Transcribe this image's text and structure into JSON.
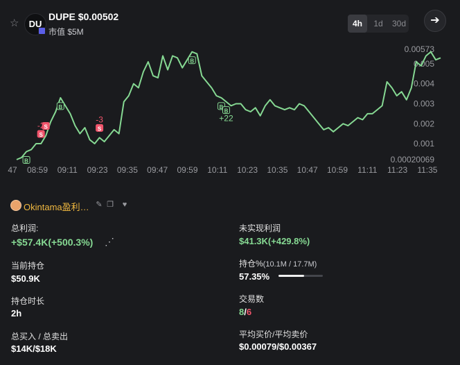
{
  "header": {
    "star_icon": "star-icon",
    "avatar_text": "DU",
    "title": "DUPE $0.00502",
    "mcap": "市值 $5M",
    "timeframes": [
      {
        "label": "4h",
        "active": true
      },
      {
        "label": "1d",
        "active": false
      },
      {
        "label": "30d",
        "active": false
      }
    ],
    "go_icon": "arrow-right-icon"
  },
  "chart_data": {
    "type": "line",
    "line_color": "#86d993",
    "x_ticks": [
      "47",
      "08:59",
      "09:11",
      "09:23",
      "09:35",
      "09:47",
      "09:59",
      "10:11",
      "10:23",
      "10:35",
      "10:47",
      "10:59",
      "11:11",
      "11:23",
      "11:35"
    ],
    "y_ticks": [
      "0.00573",
      "0.005",
      "0.004",
      "0.003",
      "0.002",
      "0.001",
      "0.00020069"
    ],
    "ylim": [
      0.00020069,
      0.00573
    ],
    "x": [
      0,
      2,
      4,
      6,
      8,
      10,
      12,
      14,
      16,
      18,
      20,
      22,
      24,
      26,
      28,
      30,
      32,
      34,
      36,
      38,
      40,
      42,
      44,
      46,
      48,
      50,
      52,
      54,
      56,
      58,
      60,
      62,
      64,
      66,
      68,
      70,
      72,
      74,
      76,
      78,
      80,
      82,
      84,
      86,
      88,
      90,
      92,
      94,
      96,
      98,
      100,
      102,
      104,
      106,
      108,
      110,
      112,
      114,
      116,
      118,
      120,
      122,
      124,
      126,
      128,
      130,
      132,
      134,
      136,
      138,
      140,
      142,
      144,
      146,
      148,
      150,
      152,
      154,
      156,
      158,
      160,
      162,
      164,
      166,
      168,
      170,
      172,
      174
    ],
    "y": [
      0.0002,
      0.0003,
      0.0006,
      0.0007,
      0.001,
      0.001,
      0.0014,
      0.0021,
      0.0026,
      0.0033,
      0.0029,
      0.0025,
      0.0019,
      0.0015,
      0.0018,
      0.0012,
      0.001,
      0.0013,
      0.0011,
      0.0014,
      0.0017,
      0.0015,
      0.0031,
      0.0034,
      0.004,
      0.0038,
      0.0046,
      0.0051,
      0.0044,
      0.0043,
      0.0054,
      0.0047,
      0.0054,
      0.0053,
      0.0048,
      0.0052,
      0.0056,
      0.0055,
      0.0044,
      0.0041,
      0.0038,
      0.0034,
      0.0033,
      0.0031,
      0.0029,
      0.003,
      0.003,
      0.0027,
      0.0026,
      0.0028,
      0.0024,
      0.0029,
      0.0032,
      0.0029,
      0.0028,
      0.0027,
      0.0028,
      0.0027,
      0.003,
      0.0029,
      0.0026,
      0.0023,
      0.002,
      0.0017,
      0.0018,
      0.0016,
      0.0018,
      0.002,
      0.0019,
      0.0021,
      0.0023,
      0.0022,
      0.0025,
      0.0025,
      0.0027,
      0.0029,
      0.0041,
      0.0038,
      0.0034,
      0.0036,
      0.0032,
      0.0038,
      0.0051,
      0.0049,
      0.0054,
      0.0056,
      0.0052,
      0.0053
    ],
    "markers": [
      {
        "type": "B",
        "x": 4
      },
      {
        "type": "S",
        "x": 10,
        "label": "-2"
      },
      {
        "type": "S",
        "x": 12
      },
      {
        "type": "B",
        "x": 18
      },
      {
        "type": "S",
        "x": 34,
        "label": "-3"
      },
      {
        "type": "B",
        "x": 72
      },
      {
        "type": "B",
        "x": 84
      },
      {
        "type": "B",
        "x": 86,
        "label": "+22"
      }
    ]
  },
  "trader": {
    "avatar_icon": "trader-avatar-icon",
    "name": "Okintama盈利…",
    "edit_icon": "pencil-icon",
    "copy_icon": "copy-icon",
    "fav_icon": "heart-icon"
  },
  "stats": {
    "total_profit_label": "总利润:",
    "total_profit_value": "+$57.4K(+500.3%)",
    "unrealized_label": "未实现利润",
    "unrealized_value": "$41.3K(+429.8%)",
    "holding_label": "当前持仓",
    "holding_value": "$50.9K",
    "position_label": "持仓%",
    "position_detail": "(10.1M / 17.7M)",
    "position_value": "57.35%",
    "position_fraction": 0.5735,
    "duration_label": "持仓时长",
    "duration_value": "2h",
    "trades_label": "交易数",
    "trades_buys": "8",
    "trades_sep": "/",
    "trades_sells": "6",
    "buy_sell_label": "总买入 / 总卖出",
    "buy_sell_value": "$14K/$18K",
    "avg_label": "平均买价/平均卖价",
    "avg_value": "$0.00079/$0.00367"
  }
}
